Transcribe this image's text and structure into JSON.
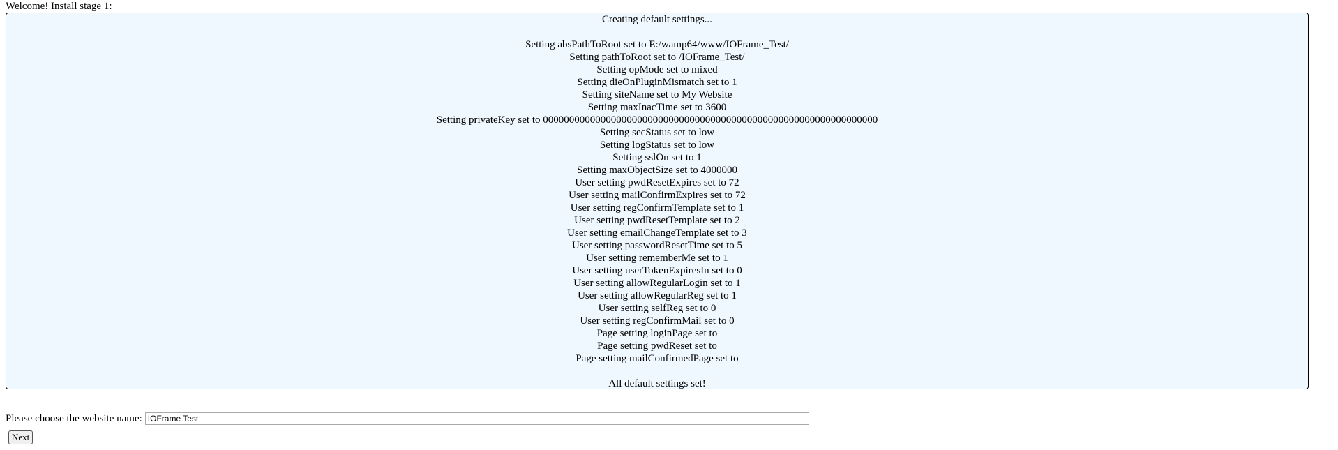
{
  "page": {
    "stage_title": "Welcome! Install stage 1:"
  },
  "log": {
    "header": "Creating default settings...",
    "lines": [
      "Setting absPathToRoot set to E:/wamp64/www/IOFrame_Test/",
      "Setting pathToRoot set to /IOFrame_Test/",
      "Setting opMode set to mixed",
      "Setting dieOnPluginMismatch set to 1",
      "Setting siteName set to My Website",
      "Setting maxInacTime set to 3600",
      "Setting privateKey set to 0000000000000000000000000000000000000000000000000000000000000000",
      "Setting secStatus set to low",
      "Setting logStatus set to low",
      "Setting sslOn set to 1",
      "Setting maxObjectSize set to 4000000",
      "User setting pwdResetExpires set to 72",
      "User setting mailConfirmExpires set to 72",
      "User setting regConfirmTemplate set to 1",
      "User setting pwdResetTemplate set to 2",
      "User setting emailChangeTemplate set to 3",
      "User setting passwordResetTime set to 5",
      "User setting rememberMe set to 1",
      "User setting userTokenExpiresIn set to 0",
      "User setting allowRegularLogin set to 1",
      "User setting allowRegularReg set to 1",
      "User setting selfReg set to 0",
      "User setting regConfirmMail set to 0",
      "Page setting loginPage set to",
      "Page setting pwdReset set to",
      "Page setting mailConfirmedPage set to"
    ],
    "footer": "All default settings set!"
  },
  "form": {
    "label": "Please choose the website name:",
    "website_name_value": "IOFrame Test",
    "next_label": "Next"
  }
}
